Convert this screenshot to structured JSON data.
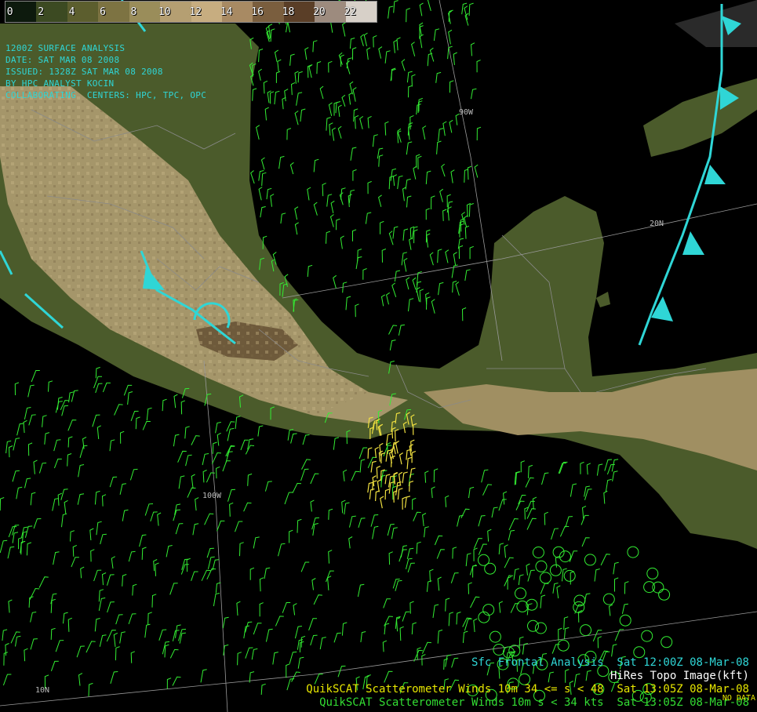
{
  "colorbar": {
    "labels": [
      "0",
      "2",
      "4",
      "6",
      "8",
      "10",
      "12",
      "14",
      "16",
      "18",
      "20",
      "22"
    ],
    "colors": [
      "#0d1a0d",
      "#3c4a22",
      "#5c5e2e",
      "#7d7342",
      "#9a8d5a",
      "#b59f72",
      "#c7ad80",
      "#a88a63",
      "#7a5e3e",
      "#5a3e27",
      "#9d8b7e",
      "#d7d0c8"
    ]
  },
  "header": {
    "line1": "1200Z SURFACE ANALYSIS",
    "line2": "DATE: SAT MAR 08 2008",
    "line3": "ISSUED: 1328Z SAT MAR 08 2008",
    "line4": "BY HPC ANALYST KOCIN",
    "line5": "COLLABORATING  CENTERS: HPC, TPC, OPC"
  },
  "gridlabels": {
    "lon_90w": "90W",
    "lat_20n": "20N",
    "lon_100w": "100W",
    "lat_10n": "10N"
  },
  "legend": {
    "front": "Sfc Frontal Analysis  Sat 12:00Z 08-Mar-08",
    "topo": "HiRes Topo Image(kft)",
    "qs_high": "QuikSCAT Scatterometer Winds 10m 34 <= s < 48  Sat 13:05Z 08-Mar-08",
    "qs_low": "QuikSCAT Scatterometer Winds 10m s < 34 kts  Sat 13:05Z 08-Mar-08",
    "nodata": "NO DATA"
  },
  "colors": {
    "front": "#2fd6d6",
    "wind_low": "#33ee33",
    "wind_high": "#f0e040",
    "ocean": "#000000",
    "lowland": "#4a5a2a",
    "highland": "#b9a97a"
  }
}
